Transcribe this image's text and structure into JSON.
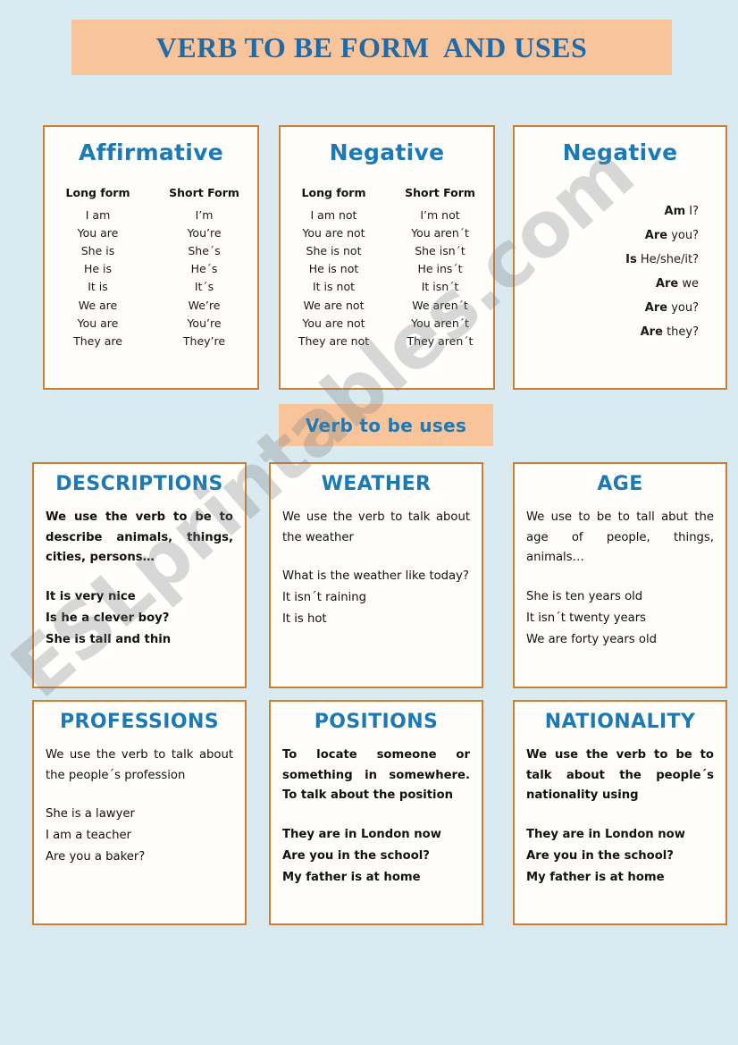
{
  "page": {
    "background_color": "#daeaf1",
    "card_border_color": "#cf7f32",
    "banner_color": "#f9c49a",
    "heading_color": "#1b7ab5",
    "title_color": "#1f6aa8"
  },
  "watermark": {
    "text": "ESLprintables.com"
  },
  "header": {
    "title": "VERB TO BE FORM  AND USES"
  },
  "uses_banner": {
    "label": "Verb to be uses"
  },
  "forms": {
    "affirmative": {
      "heading": "Affirmative",
      "columns": [
        "Long form",
        "Short Form"
      ],
      "rows": [
        [
          "I am",
          "I’m"
        ],
        [
          "You are",
          "You’re"
        ],
        [
          "She is",
          "She´s"
        ],
        [
          "He is",
          "He´s"
        ],
        [
          "It is",
          "It´s"
        ],
        [
          "We are",
          "We’re"
        ],
        [
          "You are",
          "You’re"
        ],
        [
          "They are",
          "They’re"
        ]
      ]
    },
    "negative": {
      "heading": "Negative",
      "columns": [
        "Long form",
        "Short Form"
      ],
      "rows": [
        [
          "I am not",
          "I’m not"
        ],
        [
          "You are not",
          "You aren´t"
        ],
        [
          "She is not",
          "She isn´t"
        ],
        [
          "He is not",
          "He ins´t"
        ],
        [
          "It is not",
          "It isn´t"
        ],
        [
          "We are not",
          "We aren´t"
        ],
        [
          "You are  not",
          "You aren´t"
        ],
        [
          "They are not",
          "They aren´t"
        ]
      ]
    },
    "interrogative": {
      "heading": "Negative",
      "questions": [
        {
          "aux": "Am",
          "rest": "I?"
        },
        {
          "aux": "Are",
          "rest": "you?"
        },
        {
          "aux": "Is",
          "rest": "He/she/it?"
        },
        {
          "aux": "Are",
          "rest": "we"
        },
        {
          "aux": "Are",
          "rest": "you?"
        },
        {
          "aux": "Are",
          "rest": "they?"
        }
      ]
    }
  },
  "uses": {
    "descriptions": {
      "title": "DESCRIPTIONS",
      "body": "We use the verb to be to describe animals, things, cities, persons…",
      "examples": [
        "It is very nice",
        "Is he a clever boy?",
        "She is tall and thin"
      ]
    },
    "weather": {
      "title": "WEATHER",
      "body": "We use the verb to talk about the weather",
      "examples": [
        "What is the weather like today?",
        "It isn´t raining",
        "It is hot"
      ]
    },
    "age": {
      "title": "AGE",
      "body": "We use to be to tall abut the age of people, things, animals…",
      "examples": [
        "She is ten years old",
        "It isn´t  twenty years",
        "We are forty years old"
      ]
    },
    "professions": {
      "title": "PROFESSIONS",
      "body": "We use the verb to talk about the people´s profession",
      "examples": [
        "She is a lawyer",
        "I am a teacher",
        "Are you a baker?"
      ]
    },
    "positions": {
      "title": "POSITIONS",
      "body": "To locate someone or something in somewhere. To talk about the position",
      "examples": [
        "They are in London now",
        "Are you in the school?",
        "My father is at home"
      ]
    },
    "nationality": {
      "title": "NATIONALITY",
      "body": "We use the verb to be to talk about the people´s nationality using",
      "examples": [
        "They are in London now",
        "Are you in the school?",
        "My father is at home"
      ]
    }
  }
}
